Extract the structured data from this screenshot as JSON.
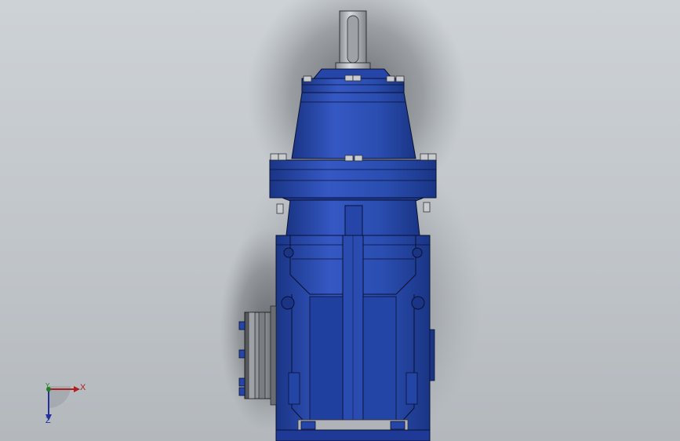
{
  "view": {
    "background_top": "#cdd2d6",
    "background_bottom": "#b3b8bd",
    "model_color": "#2a4db0",
    "model_dark": "#1a3585",
    "shaft_color": "#b8bcc0",
    "edge_color": "#0a1030"
  },
  "triad": {
    "x_label": "X",
    "y_label": "Y",
    "z_label": "Z",
    "x_color": "#b02020",
    "y_color": "#208020",
    "z_color": "#2030a0"
  }
}
